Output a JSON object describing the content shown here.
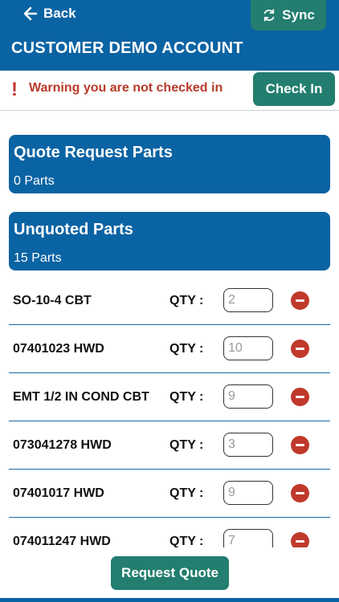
{
  "header": {
    "back_label": "Back",
    "sync_label": "Sync",
    "account_title": "CUSTOMER DEMO ACCOUNT"
  },
  "warning": {
    "icon": "!",
    "text": "Warning you are not checked in",
    "checkin_label": "Check In"
  },
  "quote_section": {
    "title": "Quote Request Parts",
    "count": "0 Parts"
  },
  "unquoted_section": {
    "title": "Unquoted Parts",
    "count": "15 Parts"
  },
  "qty_label": "QTY :",
  "parts": [
    {
      "name": "SO-10-4 CBT",
      "qty": "2"
    },
    {
      "name": "07401023 HWD",
      "qty": "10"
    },
    {
      "name": "EMT 1/2 IN COND CBT",
      "qty": "9"
    },
    {
      "name": "073041278 HWD",
      "qty": "3"
    },
    {
      "name": "07401017 HWD",
      "qty": "9"
    },
    {
      "name": "074011247 HWD",
      "qty": "7"
    }
  ],
  "request_quote_label": "Request Quote",
  "colors": {
    "primary": "#0a63a3",
    "action": "#237e6f",
    "warning": "#b83a28",
    "remove": "#c0392b"
  },
  "icons": {
    "back": "arrow-left-icon",
    "sync": "sync-icon",
    "warning": "exclamation-icon",
    "remove": "minus-circle-icon"
  }
}
